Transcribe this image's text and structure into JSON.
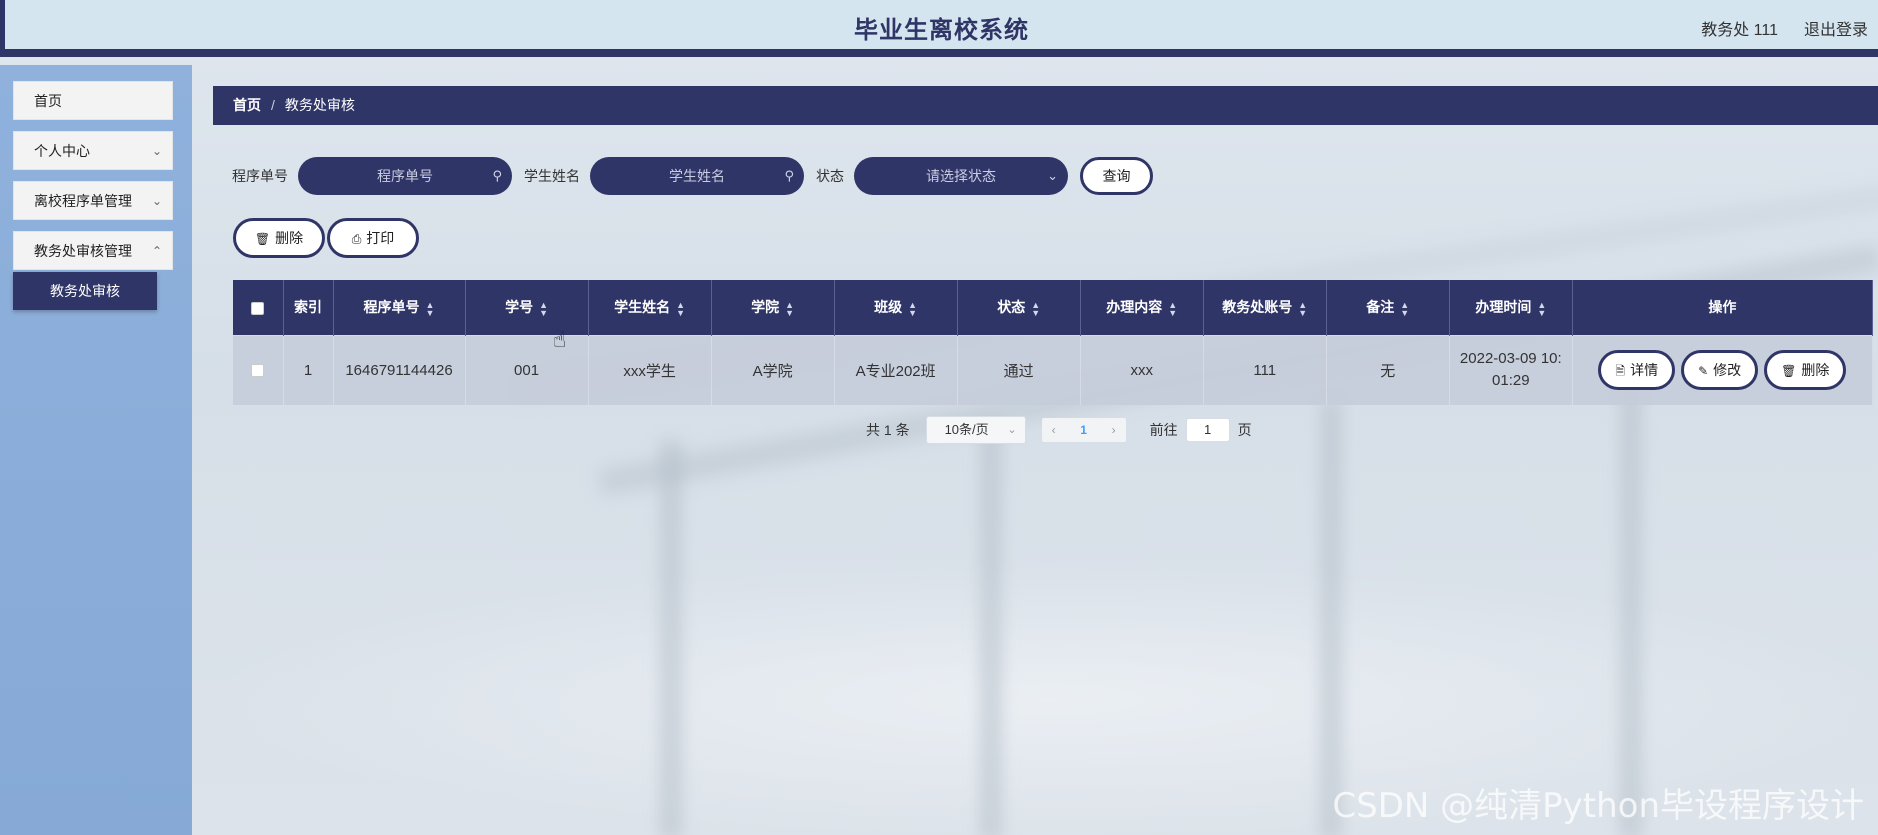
{
  "header": {
    "title": "毕业生离校系统",
    "user": "教务处 111",
    "logout": "退出登录"
  },
  "sidebar": {
    "items": [
      {
        "label": "首页"
      },
      {
        "label": "个人中心"
      },
      {
        "label": "离校程序单管理"
      },
      {
        "label": "教务处审核管理"
      }
    ],
    "submenu": "教务处审核"
  },
  "breadcrumb": {
    "home": "首页",
    "separator": "/",
    "current": "教务处审核"
  },
  "search": {
    "order_label": "程序单号",
    "order_placeholder": "程序单号",
    "name_label": "学生姓名",
    "name_placeholder": "学生姓名",
    "status_label": "状态",
    "status_placeholder": "请选择状态",
    "query_button": "查询"
  },
  "actions": {
    "delete": "删除",
    "print": "打印"
  },
  "table": {
    "columns": [
      "索引",
      "程序单号",
      "学号",
      "学生姓名",
      "学院",
      "班级",
      "状态",
      "办理内容",
      "教务处账号",
      "备注",
      "办理时间",
      "操作"
    ],
    "rows": [
      {
        "index": "1",
        "order_no": "1646791144426",
        "student_no": "001",
        "student_name": "xxx学生",
        "college": "A学院",
        "class": "A专业202班",
        "status": "通过",
        "content": "xxx",
        "account": "111",
        "remark": "无",
        "time_line1": "2022-03-09 10:",
        "time_line2": "01:29",
        "btn_detail": "详情",
        "btn_edit": "修改",
        "btn_delete": "删除"
      }
    ]
  },
  "pagination": {
    "total": "共 1 条",
    "page_size": "10条/页",
    "current_page": "1",
    "goto_label": "前往",
    "goto_value": "1",
    "page_unit": "页"
  },
  "watermark": "CSDN @纯清Python毕设程序设计",
  "colors": {
    "primary": "#2f3567",
    "header_bg": "#d5e5ef",
    "sidebar_bg": "#8fb1dc"
  }
}
